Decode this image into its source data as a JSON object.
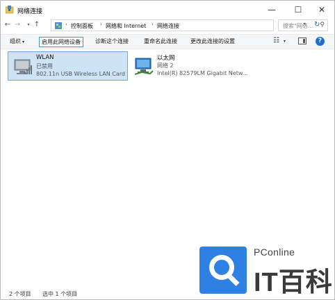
{
  "window": {
    "title": "网络连接",
    "controls": {
      "minimize": "—",
      "maximize": "☐",
      "close": "✕"
    }
  },
  "address_bar": {
    "breadcrumbs": [
      "控制面板",
      "网络和 Internet",
      "网络连接"
    ],
    "search_placeholder": "搜索\"网络...",
    "icons": {
      "back": "arrow-left",
      "forward": "arrow-right",
      "up": "arrow-up",
      "refresh": "refresh",
      "search": "magnifier"
    }
  },
  "command_bar": {
    "organize": "组织",
    "enable_device": "启用此网络设备",
    "diagnose": "诊断这个连接",
    "rename": "重命名此连接",
    "change_settings": "更改此连接的设置"
  },
  "items": [
    {
      "name": "WLAN",
      "status": "已禁用",
      "device": "802.11n USB Wireless LAN Card",
      "selected": true,
      "icon": "wireless-adapter-disabled"
    },
    {
      "name": "以太网",
      "status": "网络 2",
      "device": "Intel(R) 82579LM Gigabit Netw...",
      "selected": false,
      "icon": "ethernet-adapter"
    }
  ],
  "status_bar": {
    "item_count": "2 个项目",
    "selected_count": "选中 1 个项目"
  },
  "watermark": {
    "brand": "PConline",
    "logo_text": "IT百科"
  },
  "colors": {
    "selection_bg": "#cde4f7",
    "selection_border": "#6aa8e3",
    "help_blue": "#1d6fd6",
    "watermark_blue": "#2f80e3"
  }
}
